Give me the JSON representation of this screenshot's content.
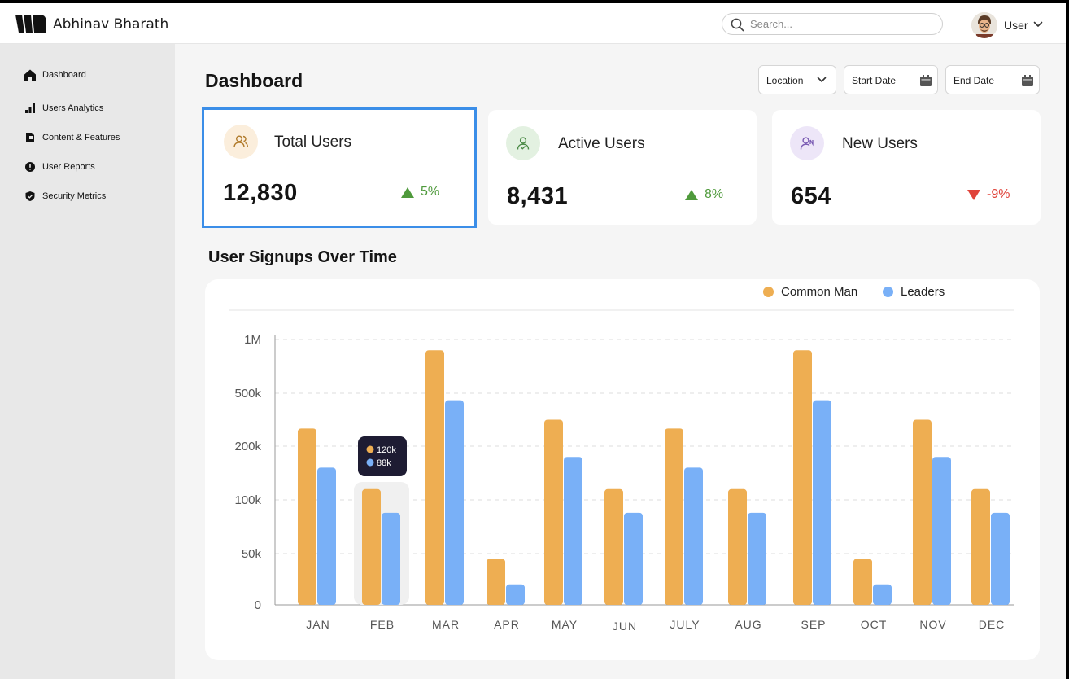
{
  "app": {
    "brand": "Abhinav Bharath"
  },
  "header": {
    "search_placeholder": "Search...",
    "user_label": "User"
  },
  "sidebar": {
    "items": [
      {
        "label": "Dashboard",
        "icon": "home-icon"
      },
      {
        "label": "Users Analytics",
        "icon": "bar-chart-icon"
      },
      {
        "label": "Content & Features",
        "icon": "document-icon"
      },
      {
        "label": "User Reports",
        "icon": "alert-icon"
      },
      {
        "label": "Security Metrics",
        "icon": "shield-icon"
      }
    ]
  },
  "main": {
    "title": "Dashboard",
    "filters": {
      "location": "Location",
      "start_date": "Start Date",
      "end_date": "End Date"
    },
    "cards": [
      {
        "title": "Total Users",
        "value": "12,830",
        "delta": "5%",
        "trend": "up",
        "icon": "users-icon",
        "color": "#b07a2a",
        "bg": "#fbeedc"
      },
      {
        "title": "Active Users",
        "value": "8,431",
        "delta": "8%",
        "trend": "up",
        "icon": "user-check-icon",
        "color": "#4a8a45",
        "bg": "#e3f1e1"
      },
      {
        "title": "New Users",
        "value": "654",
        "delta": "-9%",
        "trend": "down",
        "icon": "user-plus-icon",
        "color": "#7a5bb3",
        "bg": "#ede6f8"
      }
    ]
  },
  "colors": {
    "up": "#4f9a3c",
    "down": "#e0433a",
    "selected_border": "#3b8ee8",
    "common_man": "#eeae52",
    "leaders": "#79b0f7"
  },
  "chart_data": {
    "type": "bar",
    "title": "User Signups Over Time",
    "legend_position": "top-right",
    "grid": true,
    "categories": [
      "JAN",
      "FEB",
      "MAR",
      "APR",
      "MAY",
      "JUN",
      "JULY",
      "AUG",
      "SEP",
      "OCT",
      "NOV",
      "DEC"
    ],
    "y_ticks": [
      "0",
      "50k",
      "100k",
      "200k",
      "500k",
      "1M"
    ],
    "series": [
      {
        "name": "Common Man",
        "values": [
          300000,
          120000,
          900000,
          45000,
          350000,
          120000,
          300000,
          120000,
          900000,
          45000,
          350000,
          120000
        ]
      },
      {
        "name": "Leaders",
        "values": [
          160000,
          88000,
          460000,
          20000,
          180000,
          88000,
          160000,
          88000,
          460000,
          20000,
          180000,
          88000
        ]
      }
    ],
    "tooltip": {
      "category": "FEB",
      "common_man": "120k",
      "leaders": "88k"
    }
  }
}
